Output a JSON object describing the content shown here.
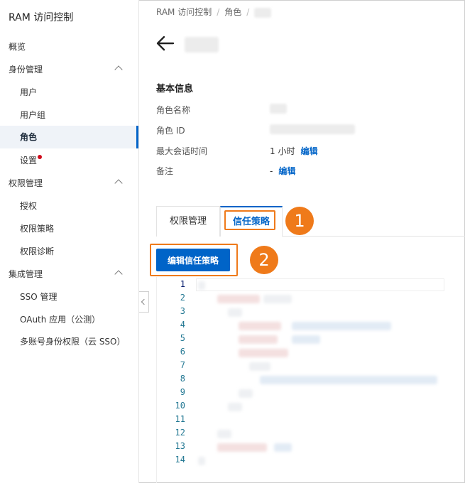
{
  "sidebar": {
    "brand": "RAM 访问控制",
    "items": [
      {
        "label": "概览"
      },
      {
        "label": "身份管理"
      },
      {
        "label": "用户"
      },
      {
        "label": "用户组"
      },
      {
        "label": "角色"
      },
      {
        "label": "设置"
      },
      {
        "label": "权限管理"
      },
      {
        "label": "授权"
      },
      {
        "label": "权限策略"
      },
      {
        "label": "权限诊断"
      },
      {
        "label": "集成管理"
      },
      {
        "label": "SSO 管理"
      },
      {
        "label": "OAuth 应用（公测）"
      },
      {
        "label": "多账号身份权限（云 SSO）"
      }
    ]
  },
  "breadcrumb": [
    "RAM 访问控制",
    "角色"
  ],
  "basic_info": {
    "title": "基本信息",
    "role_name_label": "角色名称",
    "role_id_label": "角色 ID",
    "max_session_label": "最大会话时间",
    "max_session_value": "1 小时",
    "note_label": "备注",
    "note_value": "-",
    "edit_link": "编辑"
  },
  "tabs": [
    {
      "label": "权限管理"
    },
    {
      "label": "信任策略"
    }
  ],
  "edit_policy_button": "编辑信任策略",
  "annotations": [
    "1",
    "2"
  ],
  "editor": {
    "line_numbers": [
      "1",
      "2",
      "3",
      "4",
      "5",
      "6",
      "7",
      "8",
      "9",
      "10",
      "11",
      "12",
      "13",
      "14"
    ]
  },
  "colors": {
    "accent": "#0064c8",
    "highlight": "#ef7a1a",
    "notification_dot": "#d00b1b"
  }
}
